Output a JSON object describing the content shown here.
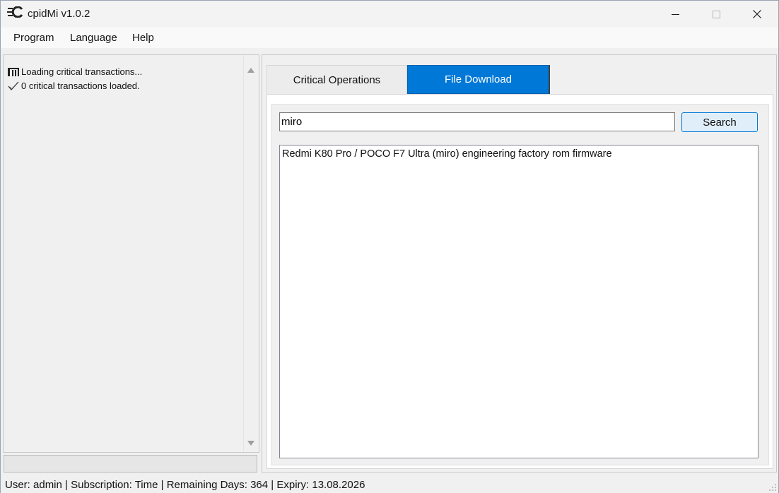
{
  "window": {
    "title": "cpidMi v1.0.2"
  },
  "menu": {
    "items": [
      {
        "label": "Program"
      },
      {
        "label": "Language"
      },
      {
        "label": "Help"
      }
    ]
  },
  "log": {
    "lines": [
      {
        "icon": "loading-bars-icon",
        "text": "Loading critical transactions..."
      },
      {
        "icon": "checkmark-icon",
        "text": "0 critical transactions loaded."
      }
    ],
    "progress": 0
  },
  "tabs": [
    {
      "label": "Critical Operations",
      "active": false
    },
    {
      "label": "File Download",
      "active": true
    }
  ],
  "file_download": {
    "search_value": "miro",
    "search_button": "Search",
    "results": [
      "Redmi K80 Pro / POCO F7 Ultra (miro) engineering factory rom firmware"
    ]
  },
  "status": {
    "text": "User: admin | Subscription: Time | Remaining Days: 364 | Expiry: 13.08.2026"
  },
  "colors": {
    "accent": "#0078d7",
    "tab_active_text": "#ffffff"
  }
}
